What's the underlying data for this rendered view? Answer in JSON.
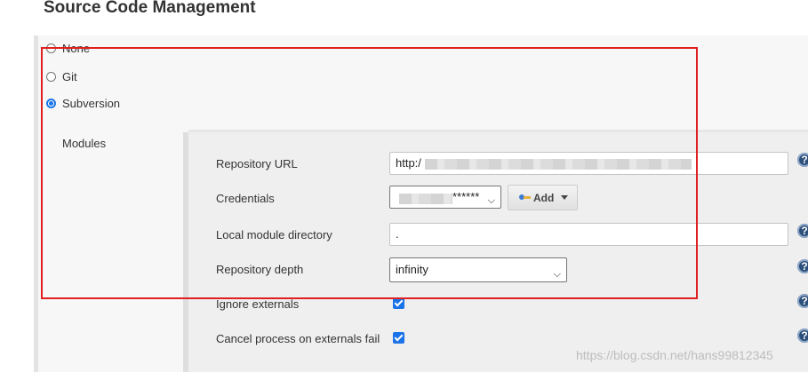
{
  "section": {
    "title": "Source Code Management"
  },
  "scm_options": [
    {
      "label": "None",
      "selected": false
    },
    {
      "label": "Git",
      "selected": false
    },
    {
      "label": "Subversion",
      "selected": true
    }
  ],
  "modules": {
    "label": "Modules",
    "repository_url": {
      "label": "Repository URL",
      "value": "http:/"
    },
    "credentials": {
      "label": "Credentials",
      "value": "******",
      "add_button": "Add"
    },
    "local_module_directory": {
      "label": "Local module directory",
      "value": "."
    },
    "repository_depth": {
      "label": "Repository depth",
      "value": "infinity"
    },
    "ignore_externals": {
      "label": "Ignore externals",
      "checked": true
    },
    "cancel_process": {
      "label": "Cancel process on externals fail",
      "checked": true
    }
  },
  "help_icon_glyph": "?",
  "watermark": "https://blog.csdn.net/hans99812345",
  "colors": {
    "accent": "#1a73e8",
    "highlight": "#e02020",
    "help_icon": "#2c4f7a"
  }
}
